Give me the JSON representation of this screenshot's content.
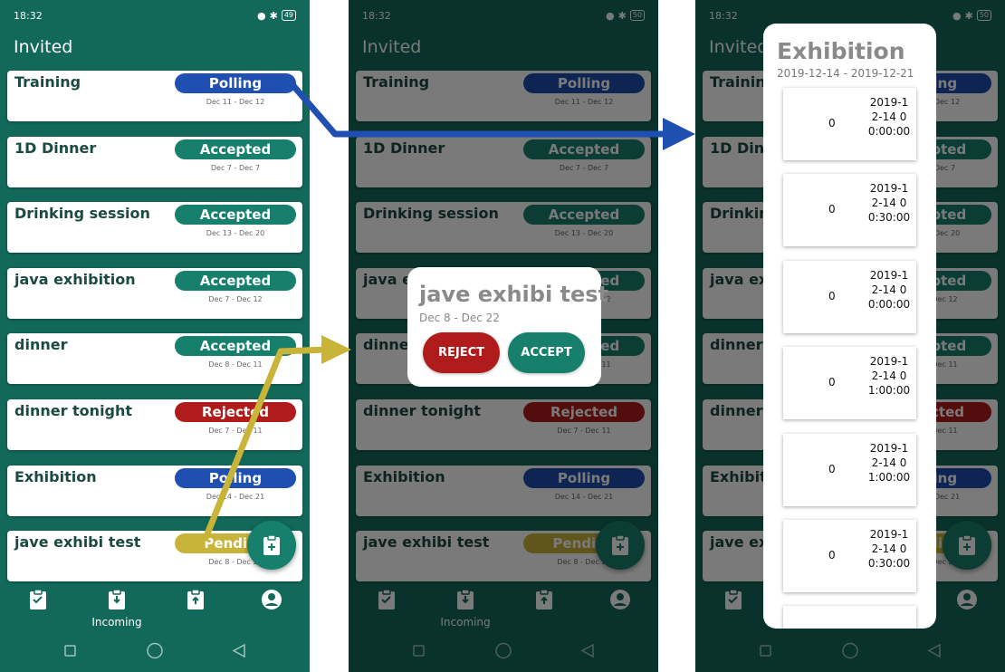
{
  "status": {
    "time": "18:32",
    "battery": [
      "49",
      "50",
      "50"
    ]
  },
  "appbar": {
    "title": "Invited"
  },
  "events": [
    {
      "title": "Training",
      "status": "Polling",
      "dates": "Dec 11 - Dec 12",
      "color": "#1f4fb0"
    },
    {
      "title": "1D Dinner",
      "status": "Accepted",
      "dates": "Dec 7 - Dec 7",
      "color": "#17806d"
    },
    {
      "title": "Drinking session",
      "status": "Accepted",
      "dates": "Dec 13 - Dec 20",
      "color": "#17806d"
    },
    {
      "title": "java exhibition",
      "status": "Accepted",
      "dates": "Dec 7 - Dec 12",
      "color": "#17806d"
    },
    {
      "title": "dinner",
      "status": "Accepted",
      "dates": "Dec 8 - Dec 11",
      "color": "#17806d"
    },
    {
      "title": "dinner tonight",
      "status": "Rejected",
      "dates": "Dec 7 - Dec 11",
      "color": "#b01c1c"
    },
    {
      "title": "Exhibition",
      "status": "Polling",
      "dates": "Dec 14 - Dec 21",
      "color": "#1f4fb0"
    },
    {
      "title": "jave exhibi test",
      "status": "Pending",
      "dates": "Dec 8 - Dec 22",
      "color": "#c9b43a"
    }
  ],
  "nav": {
    "incoming_label": "Incoming"
  },
  "respond_dialog": {
    "title": "jave exhibi test",
    "dates": "Dec 8 - Dec 22",
    "reject_label": "REJECT",
    "accept_label": "ACCEPT",
    "reject_color": "#b01c1c",
    "accept_color": "#17806d"
  },
  "poll_dialog": {
    "title": "Exhibition",
    "dates": "2019-12-14 - 2019-12-21",
    "slots": [
      {
        "count": "0",
        "time": "2019-12-14 00:00:00"
      },
      {
        "count": "0",
        "time": "2019-12-14 00:30:00"
      },
      {
        "count": "0",
        "time": "2019-12-14 00:00:00"
      },
      {
        "count": "0",
        "time": "2019-12-14 01:00:00"
      },
      {
        "count": "0",
        "time": "2019-12-14 01:00:00"
      },
      {
        "count": "0",
        "time": "2019-12-14 00:30:00"
      }
    ]
  },
  "arrows": {
    "blue": "#1f4fb0",
    "gold": "#c9b43a"
  }
}
